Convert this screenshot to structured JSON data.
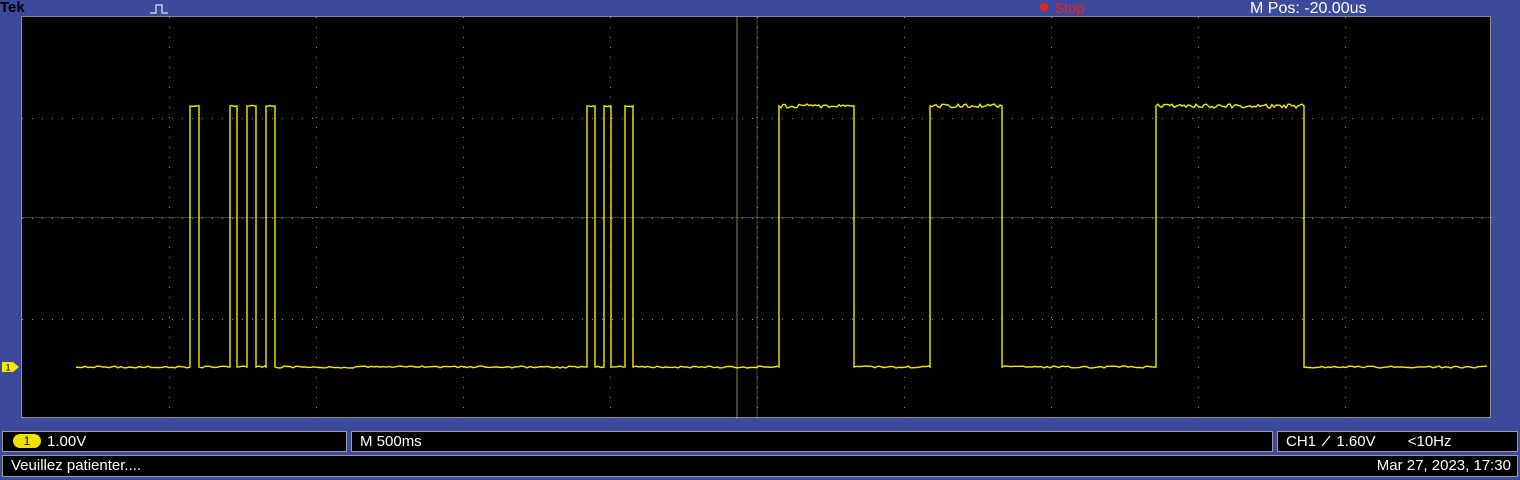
{
  "header": {
    "brand": "Tek",
    "trigger_icon": "pulse-trigger-icon",
    "acquisition_status": "Stop",
    "horizontal_position": "M Pos: -20.00us"
  },
  "colors": {
    "frame": "#3c4a9c",
    "screen": "#000000",
    "trace": "#f5eb00",
    "status_red": "#ff1a1a",
    "grid": "#9a9a9a"
  },
  "channel_marker": "1",
  "channel_bar": {
    "channel": "1",
    "volts_per_div": "1.00V"
  },
  "timebase_bar": {
    "time_per_div": "M 500ms"
  },
  "trigger_bar": {
    "source": "CH1",
    "slope_icon": "rising-edge-icon",
    "level": "1.60V",
    "frequency": "<10Hz"
  },
  "status_bar": {
    "message": "Veuillez patienter....",
    "datetime": "Mar 27, 2023, 17:30"
  }
}
